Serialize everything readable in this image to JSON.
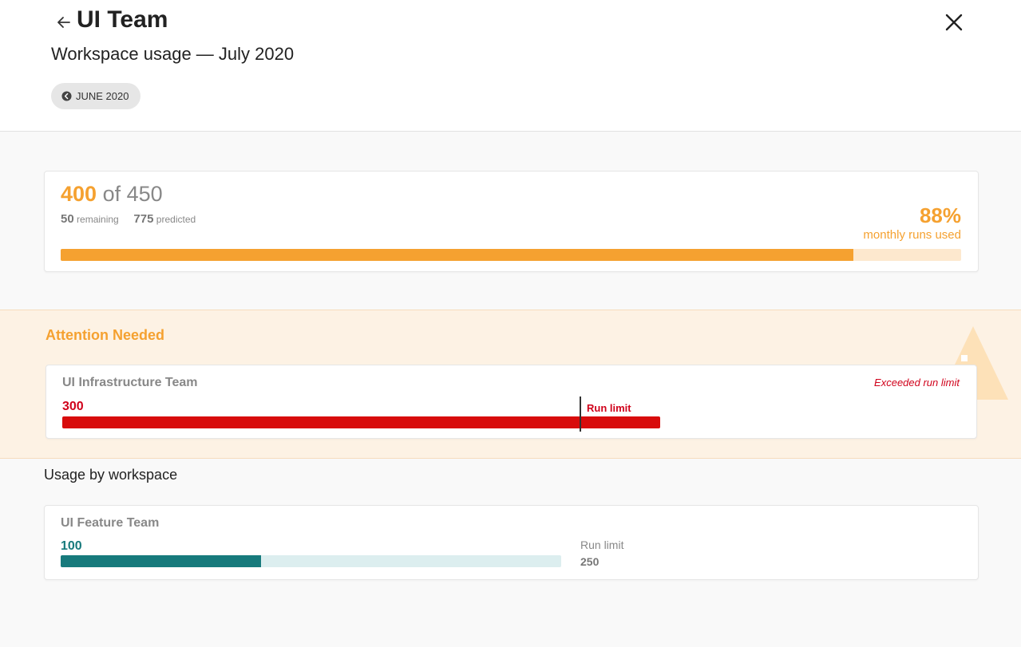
{
  "header": {
    "title": "UI Team",
    "subtitle": "Workspace usage — July 2020",
    "prev_month_label": "JUNE 2020",
    "icons": {
      "back": "arrow-left-icon",
      "close": "close-icon",
      "prev_month": "chevron-left-circle-icon"
    }
  },
  "summary": {
    "used": "400",
    "of_label": "of",
    "total": "450",
    "remaining_value": "50",
    "remaining_label": "remaining",
    "predicted_value": "775",
    "predicted_label": "predicted",
    "percent": "88%",
    "percent_label": "monthly runs used",
    "used_fraction": 0.88,
    "color": "#f5a130"
  },
  "attention": {
    "title": "Attention Needed",
    "icon": "warning-icon",
    "workspace": {
      "name": "UI Infrastructure Team",
      "status": "Exceeded run limit",
      "count": "300",
      "limit_label": "Run limit",
      "color": "#d0021b"
    }
  },
  "usage": {
    "heading": "Usage by workspace",
    "workspaces": [
      {
        "name": "UI Feature Team",
        "count": "100",
        "limit_label": "Run limit",
        "limit_value": "250",
        "used_fraction": 0.4,
        "color": "#177a7c"
      }
    ]
  }
}
